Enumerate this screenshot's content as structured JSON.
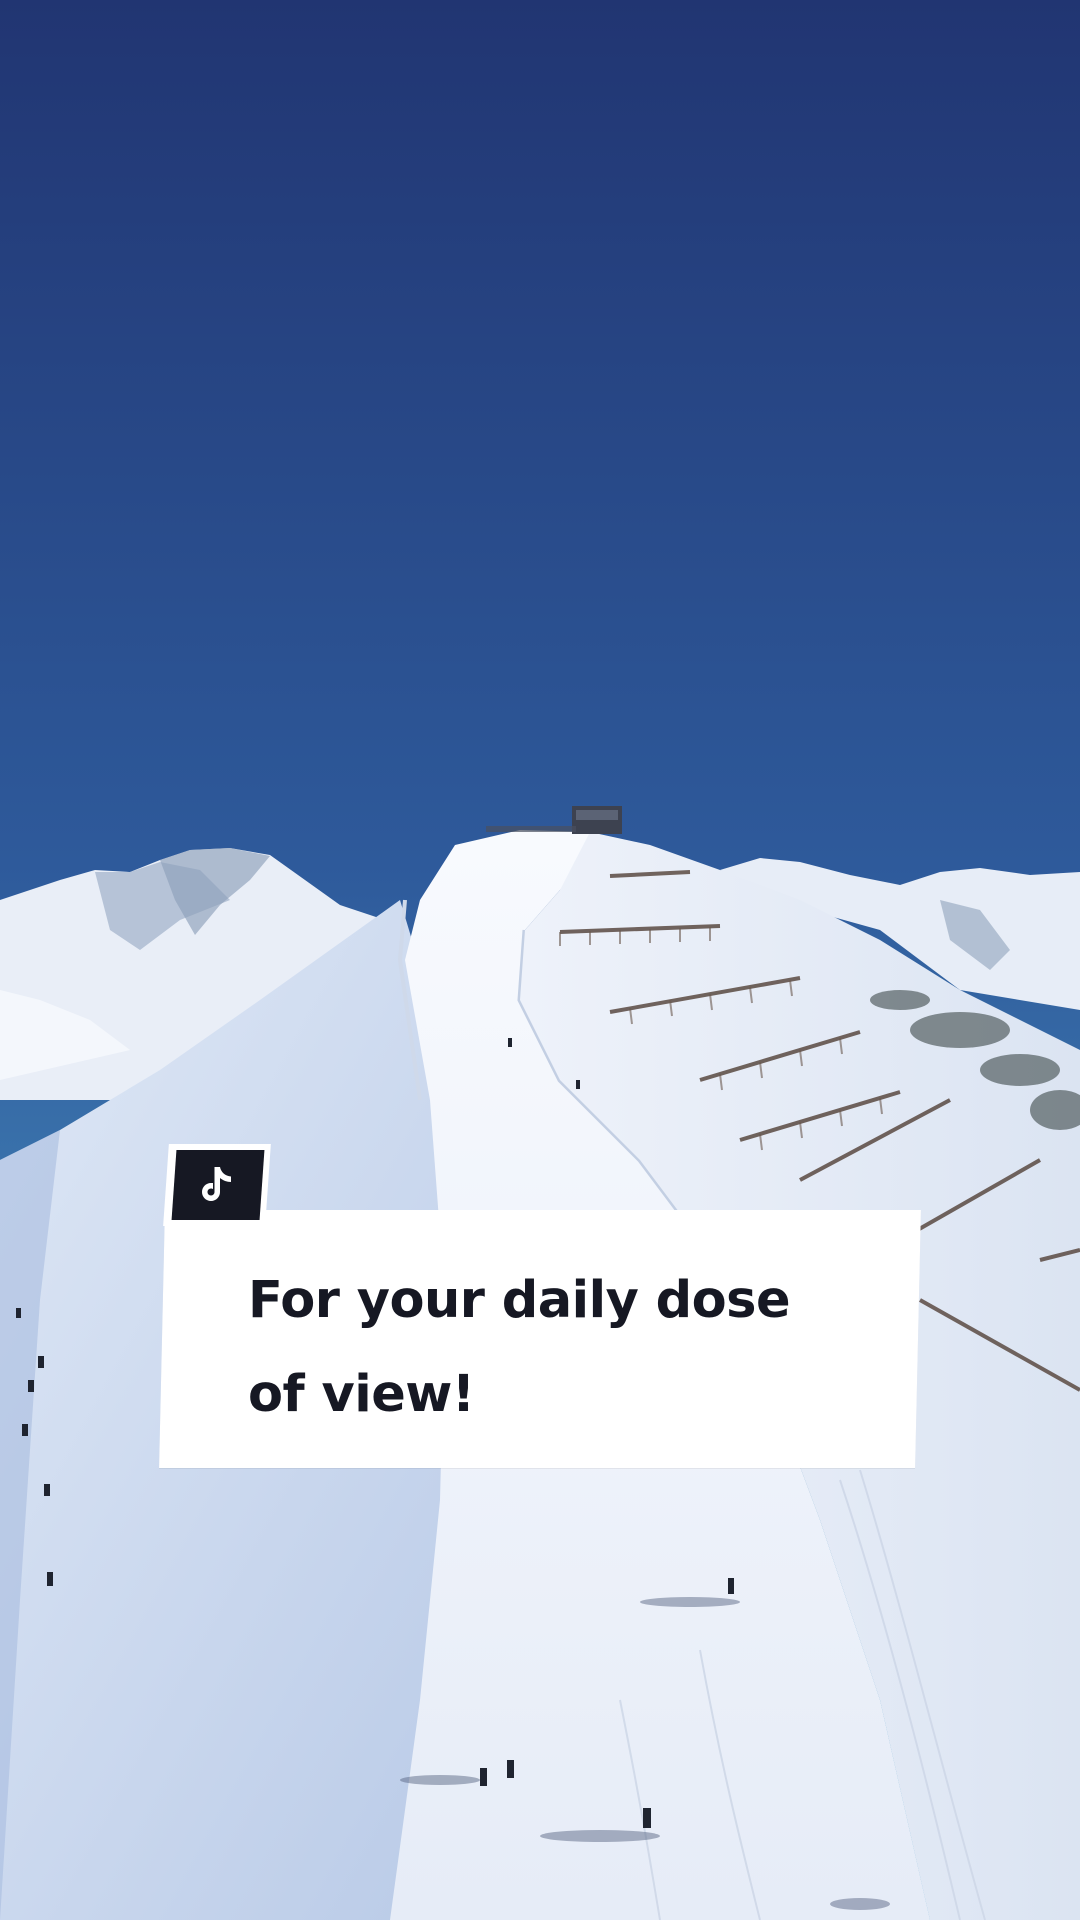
{
  "scene": {
    "description_icon": "mountain-ski-slope-scene",
    "sky_top_color": "#213572",
    "sky_bottom_color": "#4b95c3",
    "snow_color": "#f2f5fb"
  },
  "caption": {
    "line1": "For your daily dose",
    "line2": "of view!"
  },
  "badge": {
    "icon": "tiktok-logo-icon"
  }
}
